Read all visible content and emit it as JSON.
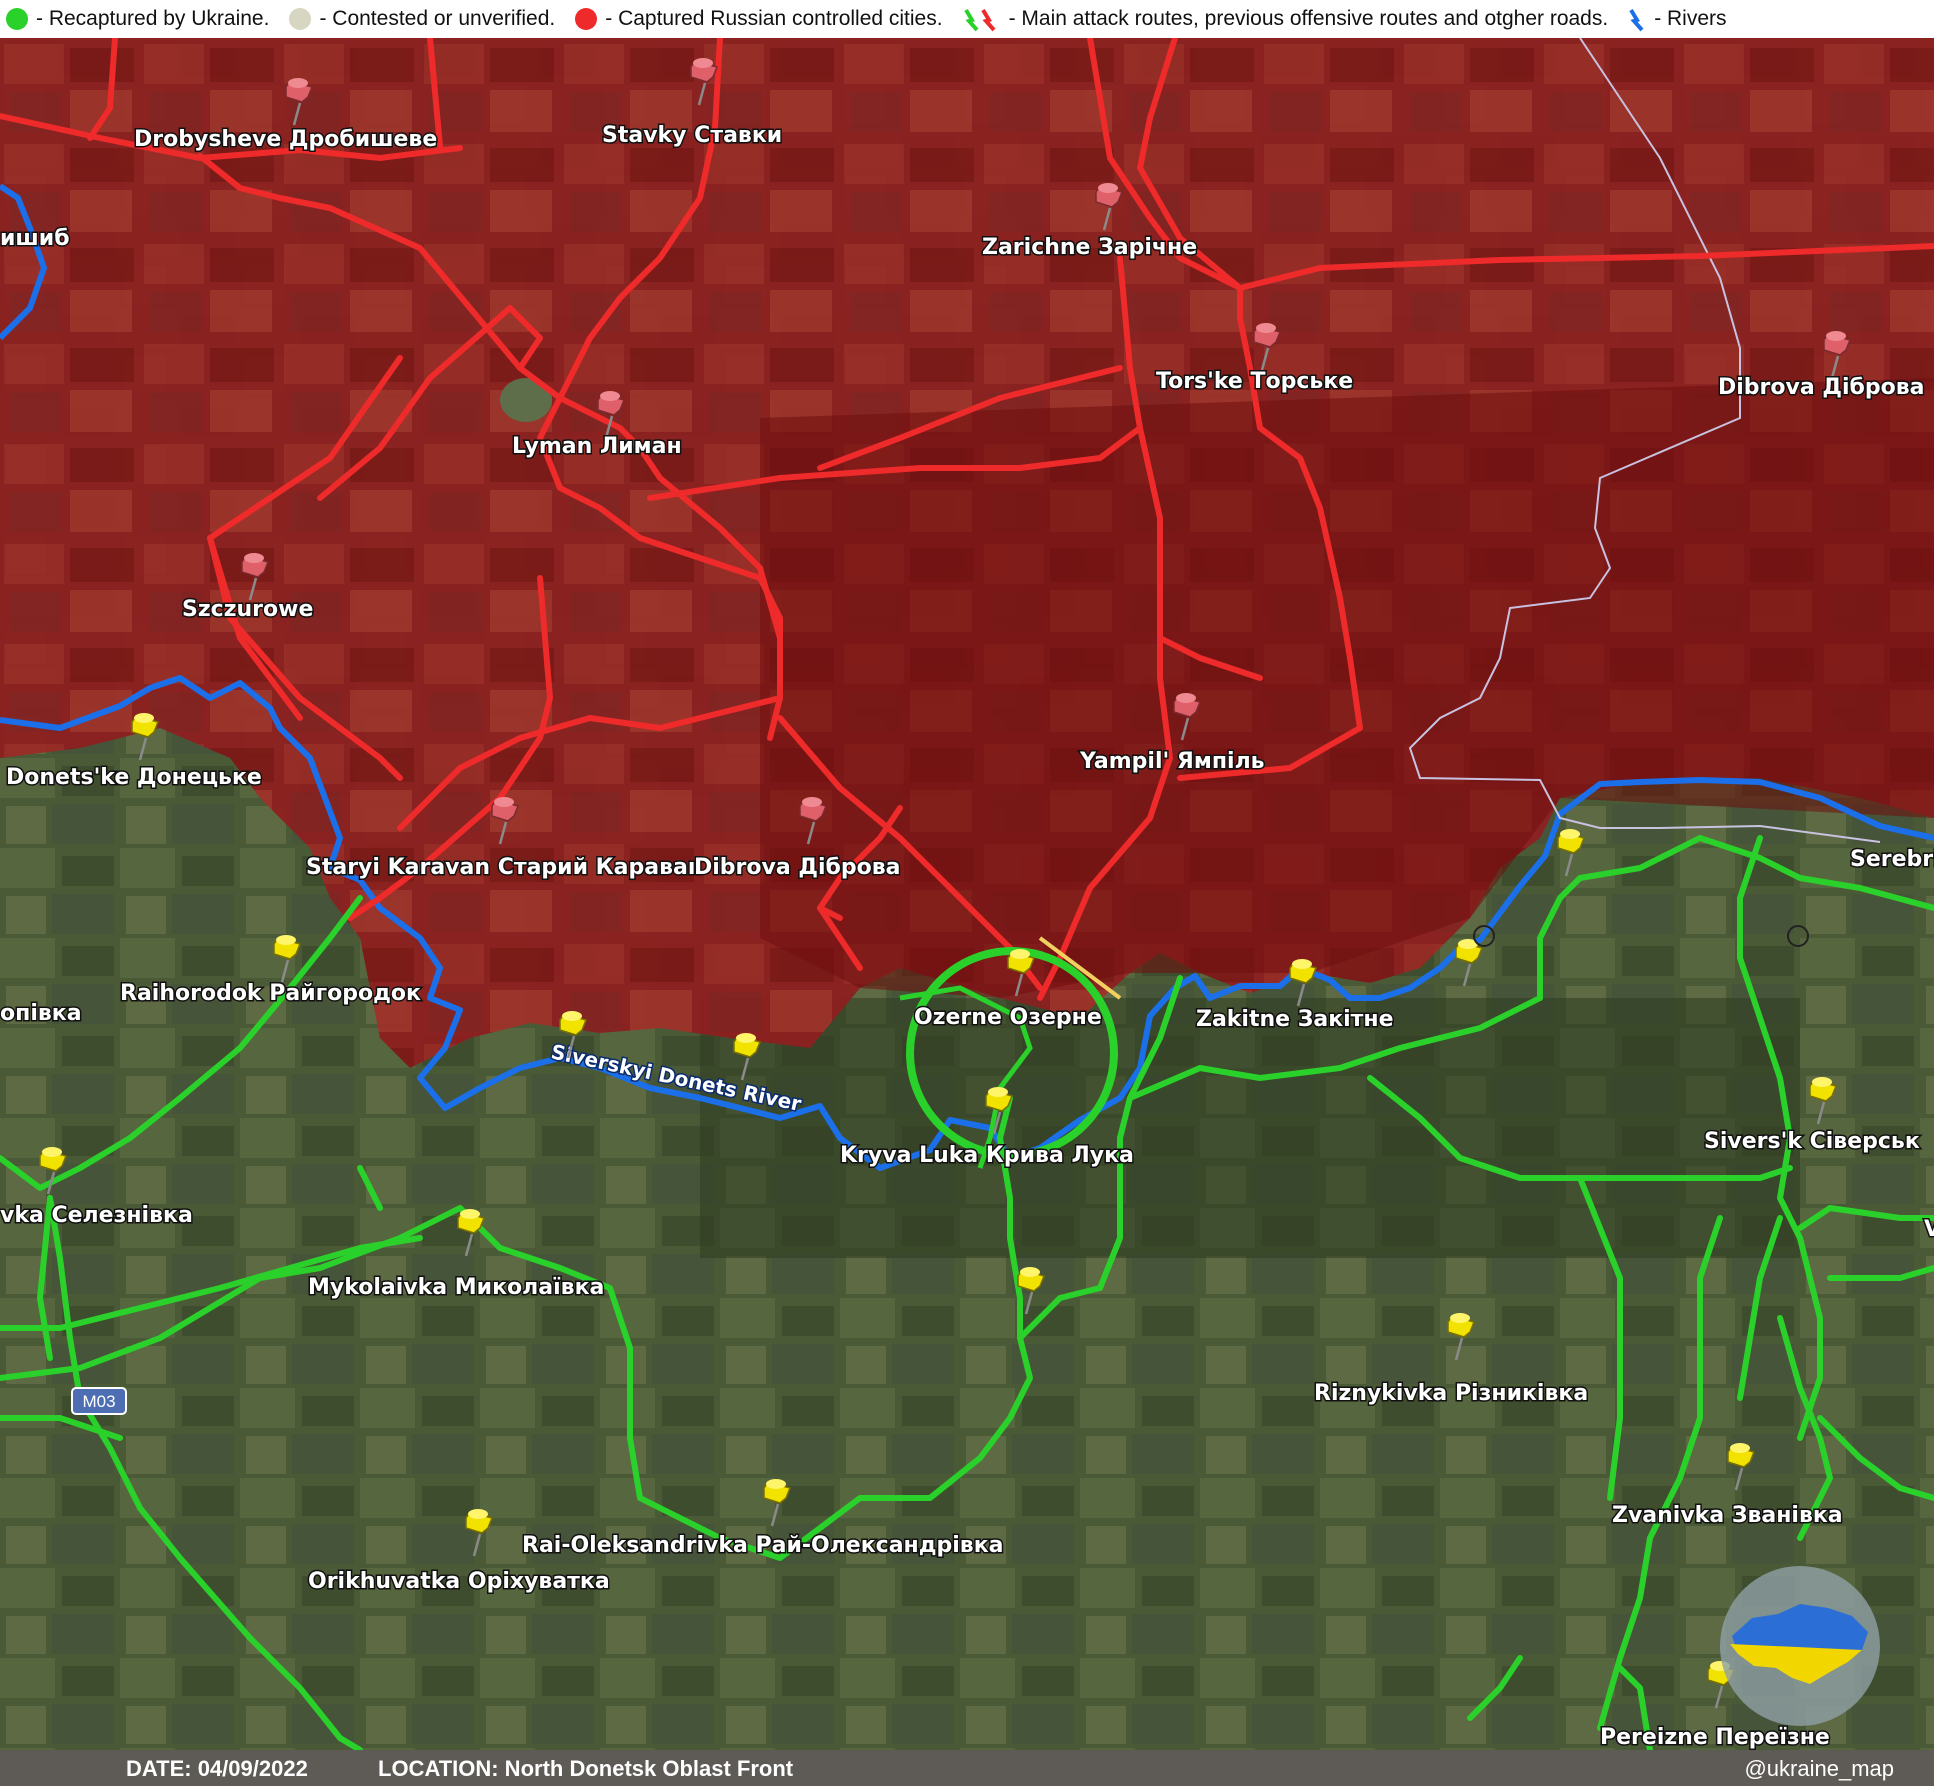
{
  "legend": {
    "recaptured": "- Recaptured by Ukraine.",
    "contested": "- Contested or unverified.",
    "captured": "- Captured Russian controlled cities.",
    "routes": "- Main attack routes, previous offensive routes and otgher roads.",
    "rivers": "- Rivers"
  },
  "colors": {
    "ukraine": "#2ad12a",
    "contested": "#d7d6c3",
    "russia": "#ee2a2a",
    "river": "#1b6fe8",
    "occupied_fill": "#8b1a1a",
    "pin_red": "#e0606a",
    "pin_yellow": "#f2e200"
  },
  "river_label": "Siverskyi Donets River",
  "road_label": "M03",
  "places": [
    {
      "id": "drobysheve",
      "name": "Drobysheve Дробишеве",
      "side": "russia"
    },
    {
      "id": "stavky",
      "name": "Stavky Ставки",
      "side": "russia"
    },
    {
      "id": "zarichne",
      "name": "Zarichne Зарічне",
      "side": "russia"
    },
    {
      "id": "torske",
      "name": "Tors'ke Торське",
      "side": "russia"
    },
    {
      "id": "dibrova-ne",
      "name": "Dibrova Діброва",
      "side": "russia"
    },
    {
      "id": "lyman",
      "name": "Lyman Лиман",
      "side": "russia"
    },
    {
      "id": "szczurowe",
      "name": "Szczurowe",
      "side": "russia"
    },
    {
      "id": "yampil",
      "name": "Yampil' Ямпіль",
      "side": "russia"
    },
    {
      "id": "staryi-karavan",
      "name": "Staryi Karavan Старий Каравaı",
      "side": "russia"
    },
    {
      "id": "dibrova",
      "name": "Dibrova Діброва",
      "side": "russia"
    },
    {
      "id": "yatske",
      "name": "ишиб",
      "side": "none"
    },
    {
      "id": "donetske",
      "name": "Donets'ke Донецьке",
      "side": "ukraine"
    },
    {
      "id": "raihorodok",
      "name": "Raihorodok Райгородок",
      "side": "ukraine"
    },
    {
      "id": "opivka",
      "name": "опівка",
      "side": "none"
    },
    {
      "id": "ozerne",
      "name": "Ozerne Озерне",
      "side": "ukraine"
    },
    {
      "id": "zakitne",
      "name": "Zakitne Закітне",
      "side": "ukraine"
    },
    {
      "id": "serebrianka",
      "name": "Serebri",
      "side": "none"
    },
    {
      "id": "kryva-luka",
      "name": "Kryva Luka Крива Лука",
      "side": "ukraine"
    },
    {
      "id": "siversk",
      "name": "Sivers'k Сіверськ",
      "side": "ukraine"
    },
    {
      "id": "seleznivka",
      "name": "vka Селезнівка",
      "side": "ukraine"
    },
    {
      "id": "mykolaivka",
      "name": "Mykolaivka Миколаївка",
      "side": "ukraine"
    },
    {
      "id": "riznykivka",
      "name": "Riznykivka Різниківка",
      "side": "ukraine"
    },
    {
      "id": "zvanivka",
      "name": "Zvanivka Званівка",
      "side": "ukraine"
    },
    {
      "id": "rai-oleksandrivka",
      "name": "Rai-Oleksandrivka Рай-Олександрівка",
      "side": "ukraine"
    },
    {
      "id": "orikhuvatka",
      "name": "Orikhuvatka Оріхуватка",
      "side": "ukraine"
    },
    {
      "id": "pereizne",
      "name": "Pereizne Переїзне",
      "side": "ukraine"
    },
    {
      "id": "edge-v",
      "name": "V",
      "side": "none"
    }
  ],
  "footer": {
    "date": "DATE: 04/09/2022",
    "location": "LOCATION: North Donetsk Oblast Front",
    "handle": "@ukraine_map"
  }
}
